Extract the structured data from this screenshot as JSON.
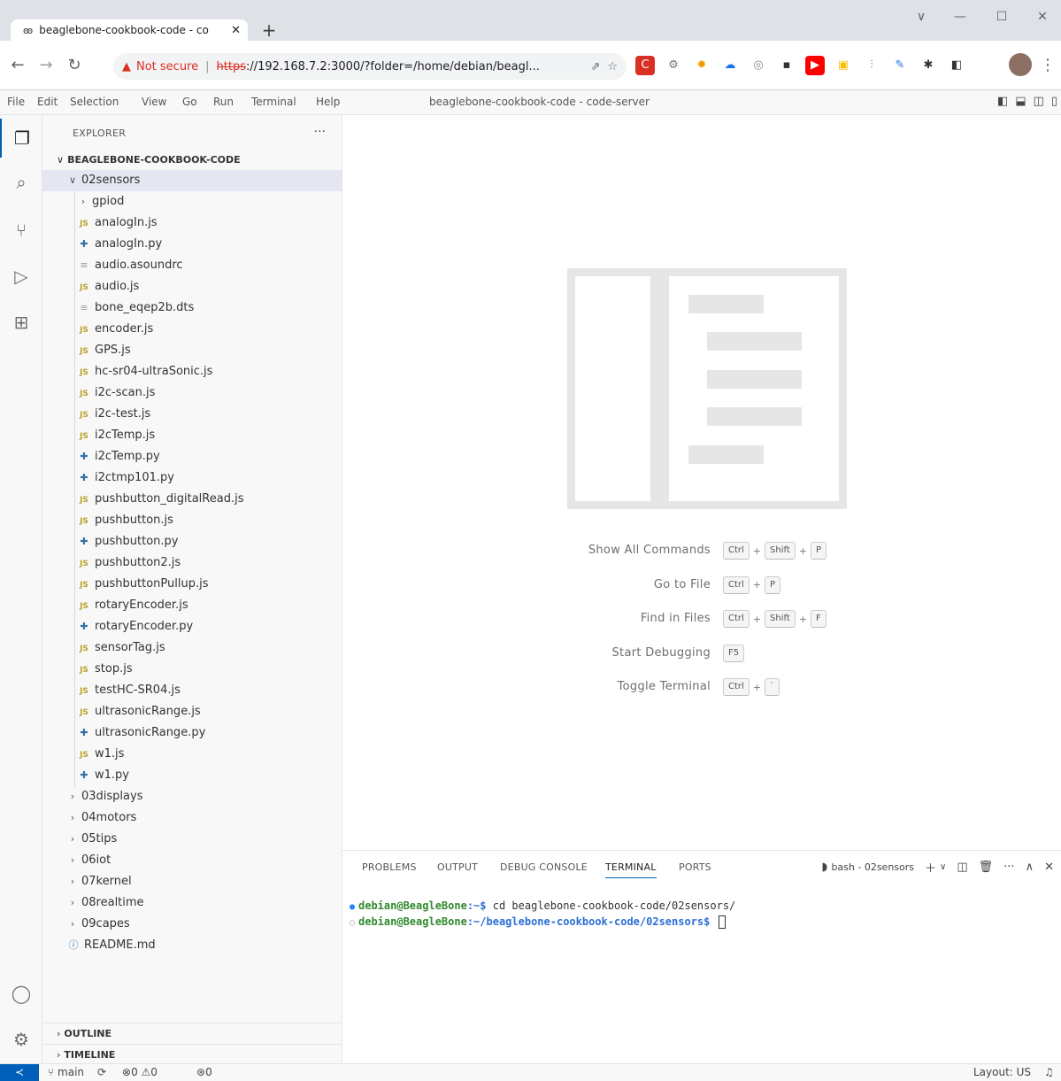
{
  "browser": {
    "tab_title": "beaglebone-cookbook-code - co",
    "tab_icon": "code-server-icon",
    "new_tab": "+",
    "window_controls": [
      "∨",
      "—",
      "☐",
      "✕"
    ],
    "security_label": "Not secure",
    "url_scheme": "https",
    "url_rest": "://192.168.7.2:3000/?folder=/home/debian/beagl...",
    "extensions": [
      {
        "name": "opera-extension-icon",
        "color": "#d93025",
        "glyph": "C"
      },
      {
        "name": "gear-extension-icon",
        "color": "#777777",
        "glyph": "⚙"
      },
      {
        "name": "sun-extension-icon",
        "color": "#f29900",
        "glyph": "✹"
      },
      {
        "name": "cloud-extension-icon",
        "color": "#1a73e8",
        "glyph": "☁"
      },
      {
        "name": "circle-extension-icon",
        "color": "#888888",
        "glyph": "◎"
      },
      {
        "name": "terminal-extension-icon",
        "color": "#333333",
        "glyph": "▪"
      },
      {
        "name": "youtube-extension-icon",
        "color": "#ff0000",
        "glyph": "▶"
      },
      {
        "name": "keep-extension-icon",
        "color": "#fbbc04",
        "glyph": "▣"
      },
      {
        "name": "bottle-extension-icon",
        "color": "#666666",
        "glyph": "⫶"
      },
      {
        "name": "feather-extension-icon",
        "color": "#1a73e8",
        "glyph": "✎"
      },
      {
        "name": "puzzle-extension-icon",
        "color": "#333333",
        "glyph": "✱"
      },
      {
        "name": "sidepanel-icon",
        "color": "#333333",
        "glyph": "◧"
      }
    ]
  },
  "menubar": {
    "items": [
      "File",
      "Edit",
      "Selection",
      "View",
      "Go",
      "Run",
      "Terminal",
      "Help"
    ],
    "title": "beaglebone-cookbook-code - code-server"
  },
  "sidebar": {
    "title": "EXPLORER",
    "more": "···",
    "root": "BEAGLEBONE-COOKBOOK-CODE",
    "tree": [
      {
        "label": "02sensors",
        "kind": "folder-open",
        "depth": 1,
        "selected": true
      },
      {
        "label": "gpiod",
        "kind": "folder",
        "depth": 2
      },
      {
        "label": "analogIn.js",
        "kind": "js",
        "depth": 2
      },
      {
        "label": "analogIn.py",
        "kind": "py",
        "depth": 2
      },
      {
        "label": "audio.asoundrc",
        "kind": "txt",
        "depth": 2
      },
      {
        "label": "audio.js",
        "kind": "js",
        "depth": 2
      },
      {
        "label": "bone_eqep2b.dts",
        "kind": "txt",
        "depth": 2
      },
      {
        "label": "encoder.js",
        "kind": "js",
        "depth": 2
      },
      {
        "label": "GPS.js",
        "kind": "js",
        "depth": 2
      },
      {
        "label": "hc-sr04-ultraSonic.js",
        "kind": "js",
        "depth": 2
      },
      {
        "label": "i2c-scan.js",
        "kind": "js",
        "depth": 2
      },
      {
        "label": "i2c-test.js",
        "kind": "js",
        "depth": 2
      },
      {
        "label": "i2cTemp.js",
        "kind": "js",
        "depth": 2
      },
      {
        "label": "i2cTemp.py",
        "kind": "py",
        "depth": 2
      },
      {
        "label": "i2ctmp101.py",
        "kind": "py",
        "depth": 2
      },
      {
        "label": "pushbutton_digitalRead.js",
        "kind": "js",
        "depth": 2
      },
      {
        "label": "pushbutton.js",
        "kind": "js",
        "depth": 2
      },
      {
        "label": "pushbutton.py",
        "kind": "py",
        "depth": 2
      },
      {
        "label": "pushbutton2.js",
        "kind": "js",
        "depth": 2
      },
      {
        "label": "pushbuttonPullup.js",
        "kind": "js",
        "depth": 2
      },
      {
        "label": "rotaryEncoder.js",
        "kind": "js",
        "depth": 2
      },
      {
        "label": "rotaryEncoder.py",
        "kind": "py",
        "depth": 2
      },
      {
        "label": "sensorTag.js",
        "kind": "js",
        "depth": 2
      },
      {
        "label": "stop.js",
        "kind": "js",
        "depth": 2
      },
      {
        "label": "testHC-SR04.js",
        "kind": "js",
        "depth": 2
      },
      {
        "label": "ultrasonicRange.js",
        "kind": "js",
        "depth": 2
      },
      {
        "label": "ultrasonicRange.py",
        "kind": "py",
        "depth": 2
      },
      {
        "label": "w1.js",
        "kind": "js",
        "depth": 2
      },
      {
        "label": "w1.py",
        "kind": "py",
        "depth": 2
      },
      {
        "label": "03displays",
        "kind": "folder",
        "depth": 1
      },
      {
        "label": "04motors",
        "kind": "folder",
        "depth": 1
      },
      {
        "label": "05tips",
        "kind": "folder",
        "depth": 1
      },
      {
        "label": "06iot",
        "kind": "folder",
        "depth": 1
      },
      {
        "label": "07kernel",
        "kind": "folder",
        "depth": 1
      },
      {
        "label": "08realtime",
        "kind": "folder",
        "depth": 1
      },
      {
        "label": "09capes",
        "kind": "folder",
        "depth": 1
      },
      {
        "label": "README.md",
        "kind": "info",
        "depth": 1
      }
    ],
    "outline": "OUTLINE",
    "timeline": "TIMELINE",
    "js_badge": "JS"
  },
  "editor": {
    "shortcuts": [
      {
        "label": "Show All Commands",
        "keys": [
          "Ctrl",
          "Shift",
          "P"
        ]
      },
      {
        "label": "Go to File",
        "keys": [
          "Ctrl",
          "P"
        ]
      },
      {
        "label": "Find in Files",
        "keys": [
          "Ctrl",
          "Shift",
          "F"
        ]
      },
      {
        "label": "Start Debugging",
        "keys": [
          "F5"
        ]
      },
      {
        "label": "Toggle Terminal",
        "keys": [
          "Ctrl",
          "`"
        ]
      }
    ]
  },
  "panel": {
    "tabs": [
      "PROBLEMS",
      "OUTPUT",
      "DEBUG CONSOLE",
      "TERMINAL",
      "PORTS"
    ],
    "active_tab": "TERMINAL",
    "terminal_name": "bash - 02sensors",
    "terminal": [
      {
        "user": "debian@BeagleBone",
        "path": ":~$",
        "cmd": " cd beaglebone-cookbook-code/02sensors/",
        "dot": "blue"
      },
      {
        "user": "debian@BeagleBone",
        "path": ":~/beaglebone-cookbook-code/02sensors$",
        "cmd": " ",
        "dot": "gray"
      }
    ]
  },
  "statusbar": {
    "remote": "≺",
    "branch": "main",
    "errors": "0",
    "warnings": "0",
    "ports": "0",
    "layout": "Layout: US"
  }
}
